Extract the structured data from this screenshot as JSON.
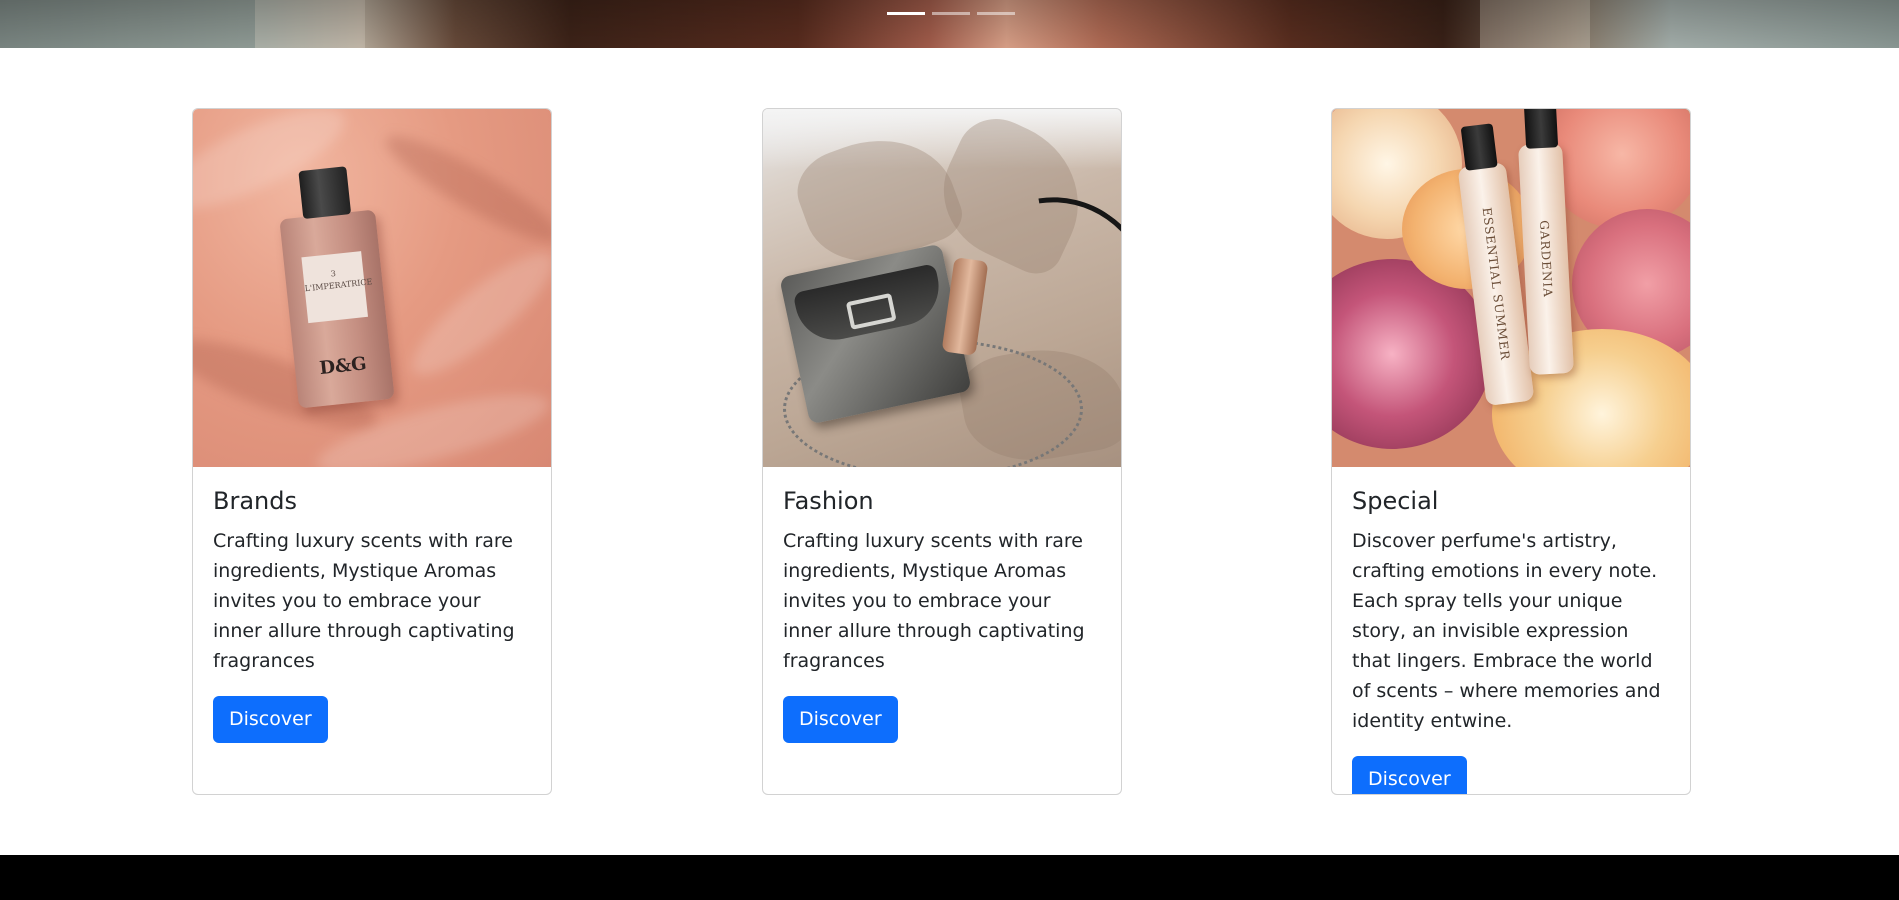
{
  "hero": {
    "indicators": [
      {
        "label": "Slide 1",
        "active": true
      },
      {
        "label": "Slide 2",
        "active": false
      },
      {
        "label": "Slide 3",
        "active": false
      }
    ]
  },
  "cards": [
    {
      "title": "Brands",
      "text": "Crafting luxury scents with rare ingredients, Mystique Aromas invites you to embrace your inner allure through captivating fragrances",
      "button": "Discover",
      "image": {
        "label_lines": [
          "3",
          "L'IMPERATRICE"
        ],
        "logo": "D&G"
      }
    },
    {
      "title": "Fashion",
      "text": "Crafting luxury scents with rare ingredients, Mystique Aromas invites you to embrace your inner allure through captivating fragrances",
      "button": "Discover"
    },
    {
      "title": "Special",
      "text": "Discover perfume's artistry, crafting emotions in every note. Each spray tells your unique story, an invisible expression that lingers. Embrace the world of scents – where memories and identity entwine.",
      "button": "Discover",
      "image": {
        "vial_left": "ESSENTIAL SUMMER",
        "vial_right": "GARDENIA"
      }
    }
  ],
  "colors": {
    "primary_button": "#0d6efd",
    "footer": "#000000"
  }
}
